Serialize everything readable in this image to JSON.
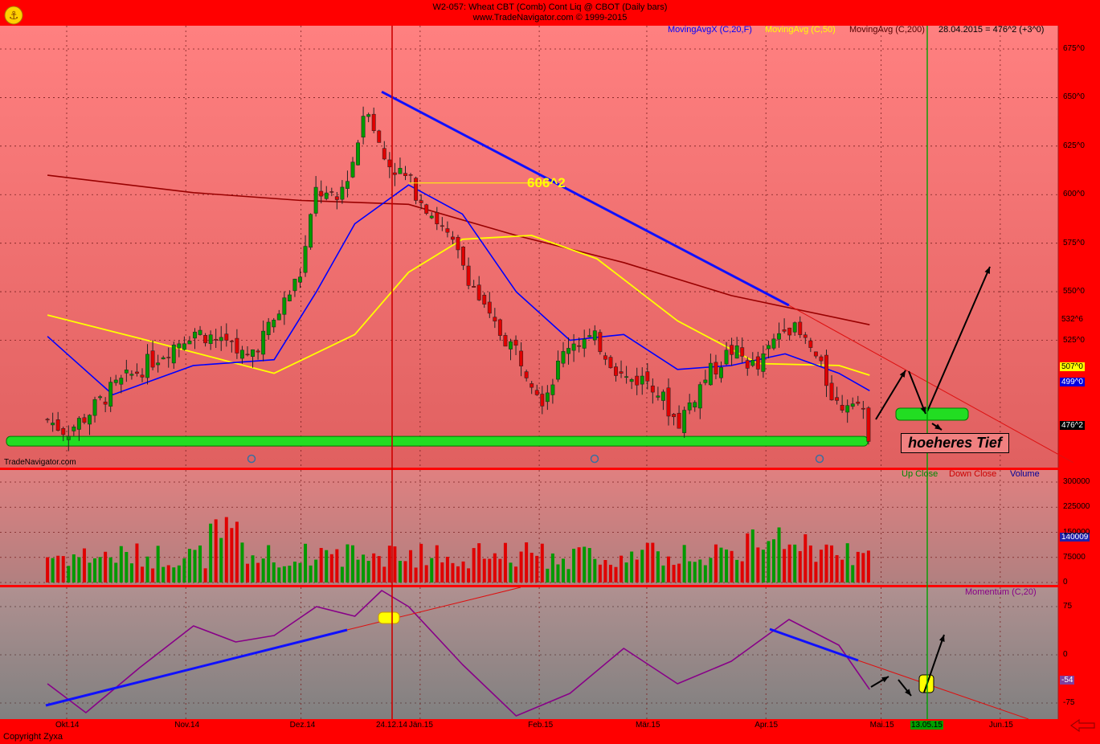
{
  "header": {
    "title": "W2-057:  Wheat CBT (Comb) Cont Liq @ CBOT  (Daily bars)",
    "subtitle": "www.TradeNavigator.com © 1999-2015"
  },
  "watermark": "TradeNavigator.com",
  "copyright": "Copyright  Zyxa",
  "price_legend": {
    "ma20": "MovingAvgX (C,20,F)",
    "ma50": "MovingAvg (C,50)",
    "ma200": "MovingAvg (C,200)",
    "last": "28.04.2015 = 476^2 (+3^0)"
  },
  "volume_legend": {
    "up": "Up Close",
    "down": "Down Close",
    "volume": "Volume"
  },
  "momentum_legend": "Momentum (C,20)",
  "annotations": {
    "level_label": "606^2",
    "note": "hoeheres Tief"
  },
  "tags": {
    "ma200": "532^6",
    "ma50": "507^0",
    "ma20": "499^0",
    "last": "476^2",
    "volume": "140009",
    "momentum": "-54"
  },
  "colors": {
    "background_top": "#ff8080",
    "background_bottom": "#e05050",
    "up": "#009900",
    "down": "#e00000",
    "ma20": "#0000ff",
    "ma50": "#ffff00",
    "ma200": "#990000",
    "frame": "#ff0000",
    "momentum": "#880088"
  },
  "chart_data": [
    {
      "type": "candlestick",
      "title": "W2-057:  Wheat CBT (Comb) Cont Liq @ CBOT  (Daily bars)",
      "y_ticks": [
        "675^0",
        "650^0",
        "625^0",
        "600^0",
        "575^0",
        "550^0",
        "525^0"
      ],
      "y_tick_values": [
        675,
        650,
        625,
        600,
        575,
        550,
        525
      ],
      "ylim": [
        459,
        687
      ],
      "x_ticks": [
        "Okt.14",
        "Nov.14",
        "Dez.14",
        "Jän.15",
        "Feb.15",
        "Mär.15",
        "Apr.15",
        "Mai.15",
        "Jun.15"
      ],
      "x_ticks_special": [
        "24.12.14",
        "13.05.15"
      ],
      "close_points": [
        {
          "date": "2014-09-26",
          "close": 484
        },
        {
          "date": "2014-10-01",
          "close": 478
        },
        {
          "date": "2014-10-06",
          "close": 486
        },
        {
          "date": "2014-10-13",
          "close": 500
        },
        {
          "date": "2014-10-20",
          "close": 510
        },
        {
          "date": "2014-10-27",
          "close": 520
        },
        {
          "date": "2014-11-03",
          "close": 530
        },
        {
          "date": "2014-11-10",
          "close": 525
        },
        {
          "date": "2014-11-17",
          "close": 516
        },
        {
          "date": "2014-11-24",
          "close": 535
        },
        {
          "date": "2014-12-01",
          "close": 560
        },
        {
          "date": "2014-12-05",
          "close": 603
        },
        {
          "date": "2014-12-10",
          "close": 595
        },
        {
          "date": "2014-12-15",
          "close": 620
        },
        {
          "date": "2014-12-18",
          "close": 650
        },
        {
          "date": "2014-12-22",
          "close": 620
        },
        {
          "date": "2014-12-29",
          "close": 607
        },
        {
          "date": "2015-01-05",
          "close": 588
        },
        {
          "date": "2015-01-12",
          "close": 565
        },
        {
          "date": "2015-01-19",
          "close": 535
        },
        {
          "date": "2015-01-26",
          "close": 520
        },
        {
          "date": "2015-02-02",
          "close": 495
        },
        {
          "date": "2015-02-09",
          "close": 525
        },
        {
          "date": "2015-02-16",
          "close": 525
        },
        {
          "date": "2015-02-23",
          "close": 505
        },
        {
          "date": "2015-03-02",
          "close": 505
        },
        {
          "date": "2015-03-09",
          "close": 482
        },
        {
          "date": "2015-03-16",
          "close": 505
        },
        {
          "date": "2015-03-23",
          "close": 520
        },
        {
          "date": "2015-03-30",
          "close": 510
        },
        {
          "date": "2015-04-06",
          "close": 535
        },
        {
          "date": "2015-04-13",
          "close": 520
        },
        {
          "date": "2015-04-20",
          "close": 490
        },
        {
          "date": "2015-04-24",
          "close": 498
        },
        {
          "date": "2015-04-28",
          "close": 476
        }
      ],
      "ma20": [
        {
          "date": "2014-09-26",
          "value": 527
        },
        {
          "date": "2014-10-13",
          "value": 497
        },
        {
          "date": "2014-11-03",
          "value": 512
        },
        {
          "date": "2014-11-24",
          "value": 515
        },
        {
          "date": "2014-12-05",
          "value": 550
        },
        {
          "date": "2014-12-15",
          "value": 585
        },
        {
          "date": "2014-12-29",
          "value": 605
        },
        {
          "date": "2015-01-12",
          "value": 590
        },
        {
          "date": "2015-01-26",
          "value": 550
        },
        {
          "date": "2015-02-09",
          "value": 525
        },
        {
          "date": "2015-02-23",
          "value": 528
        },
        {
          "date": "2015-03-09",
          "value": 510
        },
        {
          "date": "2015-03-23",
          "value": 512
        },
        {
          "date": "2015-04-06",
          "value": 518
        },
        {
          "date": "2015-04-20",
          "value": 508
        },
        {
          "date": "2015-04-28",
          "value": 499
        }
      ],
      "ma50": [
        {
          "date": "2014-09-26",
          "value": 538
        },
        {
          "date": "2014-10-20",
          "value": 526
        },
        {
          "date": "2014-11-24",
          "value": 508
        },
        {
          "date": "2014-12-15",
          "value": 528
        },
        {
          "date": "2014-12-29",
          "value": 560
        },
        {
          "date": "2015-01-12",
          "value": 577
        },
        {
          "date": "2015-01-30",
          "value": 579
        },
        {
          "date": "2015-02-16",
          "value": 567
        },
        {
          "date": "2015-03-09",
          "value": 535
        },
        {
          "date": "2015-03-30",
          "value": 513
        },
        {
          "date": "2015-04-20",
          "value": 512
        },
        {
          "date": "2015-04-28",
          "value": 507
        }
      ],
      "ma200": [
        {
          "date": "2014-09-26",
          "value": 610
        },
        {
          "date": "2014-11-03",
          "value": 601
        },
        {
          "date": "2014-12-01",
          "value": 597
        },
        {
          "date": "2014-12-29",
          "value": 595
        },
        {
          "date": "2015-01-26",
          "value": 579
        },
        {
          "date": "2015-02-23",
          "value": 565
        },
        {
          "date": "2015-03-23",
          "value": 548
        },
        {
          "date": "2015-04-28",
          "value": 533
        }
      ],
      "trendlines": [
        {
          "from": {
            "date": "2014-12-22",
            "value": 653
          },
          "to": {
            "date": "2015-04-07",
            "value": 543
          },
          "color": "blue"
        },
        {
          "from": {
            "date": "2015-04-07",
            "value": 543
          },
          "to": {
            "date": "2015-06-20",
            "value": 462
          },
          "color": "red"
        },
        {
          "from": {
            "date": "2014-12-29",
            "value": 606
          },
          "to": {
            "date": "2015-02-04",
            "value": 606
          },
          "color": "yellow"
        }
      ],
      "support_zone": {
        "value": 473
      }
    },
    {
      "type": "bar",
      "title": "Volume",
      "y_ticks": [
        "300000",
        "225000",
        "150000",
        "75000",
        "0"
      ],
      "ylim": [
        0,
        300000
      ],
      "series": [
        {
          "name": "Volume"
        }
      ],
      "last_value": 140009
    },
    {
      "type": "line",
      "title": "Momentum (C,20)",
      "y_ticks": [
        "75",
        "0",
        "-75"
      ],
      "ylim": [
        -100,
        105
      ],
      "points": [
        {
          "date": "2014-09-26",
          "value": -45
        },
        {
          "date": "2014-10-06",
          "value": -90
        },
        {
          "date": "2014-10-20",
          "value": -20
        },
        {
          "date": "2014-11-03",
          "value": 45
        },
        {
          "date": "2014-11-14",
          "value": 20
        },
        {
          "date": "2014-11-24",
          "value": 30
        },
        {
          "date": "2014-12-05",
          "value": 75
        },
        {
          "date": "2014-12-15",
          "value": 60
        },
        {
          "date": "2014-12-22",
          "value": 100
        },
        {
          "date": "2014-12-29",
          "value": 75
        },
        {
          "date": "2015-01-12",
          "value": -15
        },
        {
          "date": "2015-01-26",
          "value": -95
        },
        {
          "date": "2015-02-09",
          "value": -60
        },
        {
          "date": "2015-02-23",
          "value": 10
        },
        {
          "date": "2015-03-09",
          "value": -45
        },
        {
          "date": "2015-03-23",
          "value": -10
        },
        {
          "date": "2015-04-07",
          "value": 55
        },
        {
          "date": "2015-04-20",
          "value": 15
        },
        {
          "date": "2015-04-28",
          "value": -54
        }
      ]
    }
  ]
}
